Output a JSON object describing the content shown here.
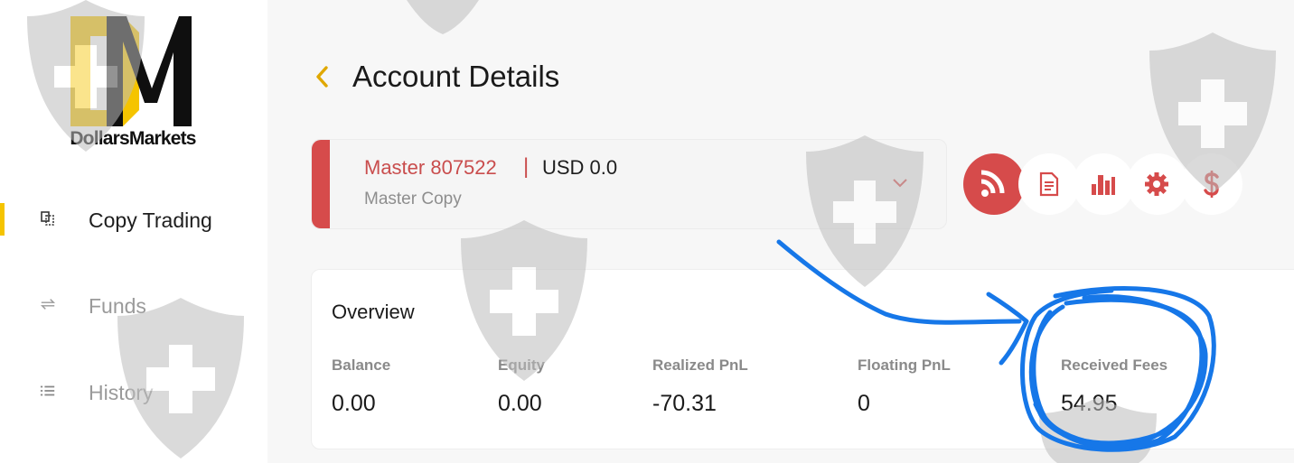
{
  "brand": {
    "name": "DollarsMarkets"
  },
  "sidebar": {
    "items": [
      {
        "label": "Copy Trading",
        "icon": "copy-trading-icon",
        "active": true
      },
      {
        "label": "Funds",
        "icon": "transfer-arrows-icon",
        "active": false
      },
      {
        "label": "History",
        "icon": "list-icon",
        "active": false
      }
    ]
  },
  "header": {
    "title": "Account Details",
    "back_icon": "chevron-left-icon"
  },
  "account": {
    "name": "Master 807522",
    "separator": "|",
    "balance": "USD 0.0",
    "type": "Master Copy",
    "dropdown_icon": "chevron-down-icon"
  },
  "actions": [
    {
      "icon": "rss-icon",
      "active": true
    },
    {
      "icon": "document-icon",
      "active": false
    },
    {
      "icon": "bar-chart-icon",
      "active": false
    },
    {
      "icon": "gear-icon",
      "active": false
    },
    {
      "icon": "dollar-icon",
      "active": false
    }
  ],
  "overview": {
    "title": "Overview",
    "metrics": [
      {
        "label": "Balance",
        "value": "0.00"
      },
      {
        "label": "Equity",
        "value": "0.00"
      },
      {
        "label": "Realized PnL",
        "value": "-70.31"
      },
      {
        "label": "Floating PnL",
        "value": "0"
      },
      {
        "label": "Received Fees",
        "value": "54.95"
      }
    ]
  },
  "colors": {
    "accent_red": "#d64b4b",
    "brand_yellow": "#f5c400",
    "annotation_blue": "#1677e8",
    "background": "#f7f7f7"
  }
}
